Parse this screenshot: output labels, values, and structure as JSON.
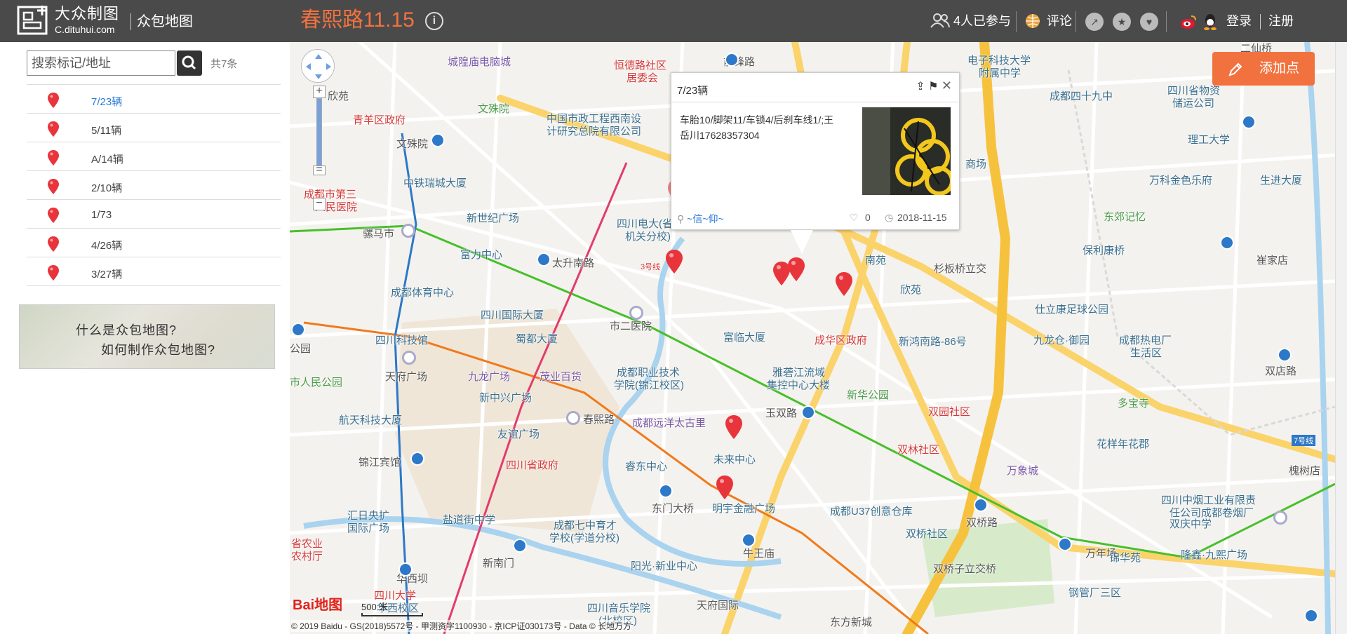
{
  "header": {
    "logo_cn": "大众制图",
    "logo_en": "C.dituhui.com",
    "app_name": "众包地图",
    "map_title": "春熙路11.15",
    "info_symbol": "i",
    "participants": "4人已参与",
    "comment": "评论",
    "login": "登录",
    "register": "注册",
    "accent_color": "#f2723f"
  },
  "sidebar": {
    "search_placeholder": "搜索标记/地址",
    "count": "共7条",
    "items": [
      {
        "label": "7/23辆",
        "active": true
      },
      {
        "label": "5/11辆"
      },
      {
        "label": "A/14辆"
      },
      {
        "label": "2/10辆"
      },
      {
        "label": "1/73"
      },
      {
        "label": "4/26辆"
      },
      {
        "label": "3/27辆"
      }
    ],
    "help_line1": "什么是众包地图?",
    "help_line2": "如何制作众包地图?"
  },
  "map": {
    "add_point": "添加点",
    "zoom_in": "+",
    "zoom_out": "−",
    "popup": {
      "title": "7/23辆",
      "description": "车胎10/脚架11/车锁4/后刹车线1/;王岳川17628357304",
      "author": "~信~仰~",
      "likes": "0",
      "date": "2018-11-15"
    },
    "pois": [
      {
        "text": "城隍庙电脑城"
      },
      {
        "text": "恒德路社区"
      },
      {
        "text": "居委会"
      },
      {
        "text": "前锋路"
      },
      {
        "text": "电子科技大学"
      },
      {
        "text": "附属中学"
      },
      {
        "text": "二仙桥"
      },
      {
        "text": "欣苑"
      },
      {
        "text": "文殊院"
      },
      {
        "text": "中国市政工程西南设"
      },
      {
        "text": "计研究总院有限公司"
      },
      {
        "text": "成都四十九中"
      },
      {
        "text": "四川省物资"
      },
      {
        "text": "储运公司"
      },
      {
        "text": "青羊区政府"
      },
      {
        "text": "文殊院"
      },
      {
        "text": "理工大学"
      },
      {
        "text": "中铁瑞城大厦"
      },
      {
        "text": "成都市第三"
      },
      {
        "text": "人民医院"
      },
      {
        "text": "商场"
      },
      {
        "text": "万科金色乐府"
      },
      {
        "text": "生进大厦"
      },
      {
        "text": "新世纪广场"
      },
      {
        "text": "四川电大(省"
      },
      {
        "text": "机关分校)"
      },
      {
        "text": "骡马市"
      },
      {
        "text": "东郊记忆"
      },
      {
        "text": "富力中心"
      },
      {
        "text": "太升南路"
      },
      {
        "text": "南苑"
      },
      {
        "text": "保利康桥"
      },
      {
        "text": "崔家店"
      },
      {
        "text": "3号线"
      },
      {
        "text": "杉板桥立交"
      },
      {
        "text": "成都体育中心"
      },
      {
        "text": "欣苑"
      },
      {
        "text": "四川国际大厦"
      },
      {
        "text": "仕立康足球公园"
      },
      {
        "text": "市二医院"
      },
      {
        "text": "富临大厦"
      },
      {
        "text": "四川科技馆"
      },
      {
        "text": "蜀都大厦"
      },
      {
        "text": "成华区政府"
      },
      {
        "text": "新鸿南路-86号"
      },
      {
        "text": "九龙仓·御园"
      },
      {
        "text": "成都热电厂"
      },
      {
        "text": "生活区"
      },
      {
        "text": "公园"
      },
      {
        "text": "天府广场"
      },
      {
        "text": "九龙广场"
      },
      {
        "text": "茂业百货"
      },
      {
        "text": "成都职业技术"
      },
      {
        "text": "学院(锦江校区)"
      },
      {
        "text": "雅砻江流域"
      },
      {
        "text": "集控中心大楼"
      },
      {
        "text": "双店路"
      },
      {
        "text": "市人民公园"
      },
      {
        "text": "新中兴广场"
      },
      {
        "text": "新华公园"
      },
      {
        "text": "多宝寺"
      },
      {
        "text": "航天科技大厦"
      },
      {
        "text": "春熙路"
      },
      {
        "text": "成都远洋太古里"
      },
      {
        "text": "玉双路"
      },
      {
        "text": "双园社区"
      },
      {
        "text": "友谊广场"
      },
      {
        "text": "双林社区"
      },
      {
        "text": "花样年花郡"
      },
      {
        "text": "7号线"
      },
      {
        "text": "锦江宾馆"
      },
      {
        "text": "四川省政府"
      },
      {
        "text": "未来中心"
      },
      {
        "text": "睿东中心"
      },
      {
        "text": "万象城"
      },
      {
        "text": "槐树店"
      },
      {
        "text": "东门大桥"
      },
      {
        "text": "明宇金融广场"
      },
      {
        "text": "成都U37创意仓库"
      },
      {
        "text": "四川中烟工业有限责"
      },
      {
        "text": "任公司成都卷烟厂"
      },
      {
        "text": "汇日央扩"
      },
      {
        "text": "国际广场"
      },
      {
        "text": "盐道街中学"
      },
      {
        "text": "双桥路"
      },
      {
        "text": "成都七中育才"
      },
      {
        "text": "学校(学道分校)"
      },
      {
        "text": "双桥社区"
      },
      {
        "text": "双庆中学"
      },
      {
        "text": "省农业"
      },
      {
        "text": "农村厅"
      },
      {
        "text": "牛王庙"
      },
      {
        "text": "新南门"
      },
      {
        "text": "万年场"
      },
      {
        "text": "隆鑫·九熙广场"
      },
      {
        "text": "阳光·新业中心"
      },
      {
        "text": "双桥子立交桥"
      },
      {
        "text": "锦华苑"
      },
      {
        "text": "华西坝"
      },
      {
        "text": "四川音乐学院"
      },
      {
        "text": "(北校区)"
      },
      {
        "text": "钢管厂三区"
      },
      {
        "text": "四川大学"
      },
      {
        "text": "华西校区"
      },
      {
        "text": "天府国际"
      },
      {
        "text": "东方新城"
      }
    ],
    "scale": "500 米",
    "baidu": "Bai地图",
    "copyright": "© 2019 Baidu - GS(2018)5572号 - 甲测资字1100930 - 京ICP证030173号 - Data © 长地万方"
  }
}
